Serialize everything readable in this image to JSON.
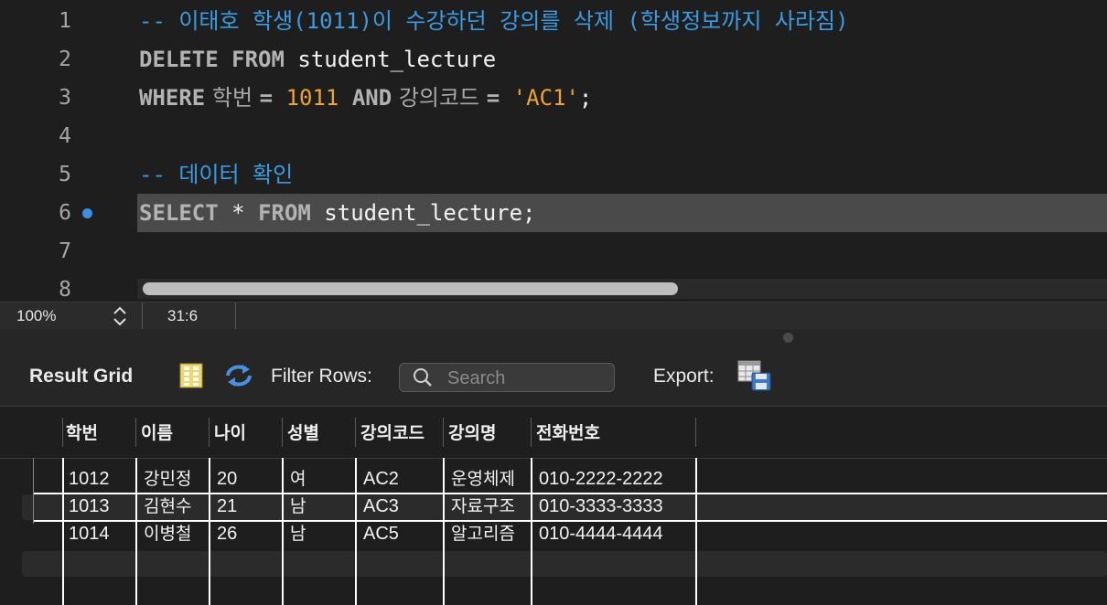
{
  "editor": {
    "lines": [
      {
        "num": "1",
        "tokens": [
          {
            "t": "-- 이태호 학생(1011)이 수강하던 강의를 삭제 (학생정보까지 사라짐)",
            "c": "cm"
          }
        ]
      },
      {
        "num": "2",
        "tokens": [
          {
            "t": "DELETE FROM",
            "c": "kw"
          },
          {
            "t": " student_lecture",
            "c": "plain"
          }
        ]
      },
      {
        "num": "3",
        "tokens": [
          {
            "t": "WHERE",
            "c": "kw"
          },
          {
            "t": " 학번 ",
            "c": "hangul"
          },
          {
            "t": "=",
            "c": "kw"
          },
          {
            "t": " ",
            "c": "plain"
          },
          {
            "t": "1011",
            "c": "num"
          },
          {
            "t": " ",
            "c": "plain"
          },
          {
            "t": "AND",
            "c": "kw"
          },
          {
            "t": " 강의코드 ",
            "c": "hangul"
          },
          {
            "t": "=",
            "c": "kw"
          },
          {
            "t": " ",
            "c": "plain"
          },
          {
            "t": "'AC1'",
            "c": "str"
          },
          {
            "t": ";",
            "c": "plain"
          }
        ]
      },
      {
        "num": "4",
        "tokens": []
      },
      {
        "num": "5",
        "tokens": [
          {
            "t": "-- 데이터 확인",
            "c": "cm"
          }
        ]
      },
      {
        "num": "6",
        "tokens": [
          {
            "t": "SELECT",
            "c": "kw"
          },
          {
            "t": " * ",
            "c": "plain"
          },
          {
            "t": "FROM",
            "c": "kw"
          },
          {
            "t": " student_lecture;",
            "c": "plain"
          }
        ],
        "current": true
      },
      {
        "num": "7",
        "tokens": []
      },
      {
        "num": "8",
        "tokens": []
      }
    ]
  },
  "status": {
    "zoom": "100%",
    "cursor": "31:6"
  },
  "toolbar": {
    "result_grid": "Result Grid",
    "filter_rows": "Filter Rows:",
    "search_placeholder": "Search",
    "export": "Export:"
  },
  "grid": {
    "columns": [
      "학번",
      "이름",
      "나이",
      "성별",
      "강의코드",
      "강의명",
      "전화번호"
    ],
    "rows": [
      [
        "1012",
        "강민정",
        "20",
        "여",
        "AC2",
        "운영체제",
        "010-2222-2222"
      ],
      [
        "1013",
        "김현수",
        "21",
        "남",
        "AC3",
        "자료구조",
        "010-3333-3333"
      ],
      [
        "1014",
        "이병철",
        "26",
        "남",
        "AC5",
        "알고리즘",
        "010-4444-4444"
      ]
    ]
  }
}
